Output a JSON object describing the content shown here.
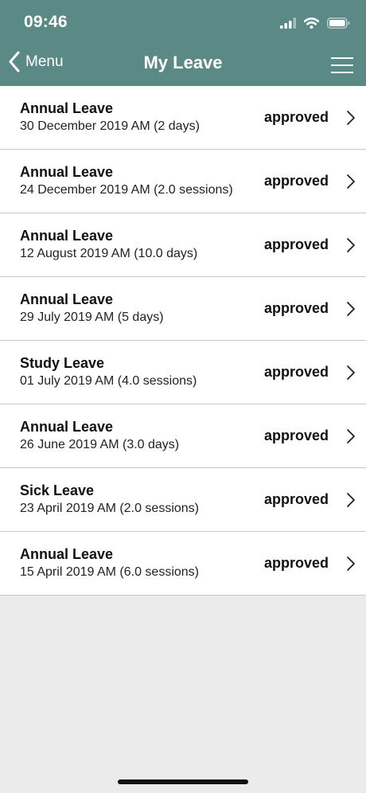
{
  "status_bar": {
    "time": "09:46"
  },
  "nav": {
    "back_label": "Menu",
    "title": "My Leave"
  },
  "leave_items": [
    {
      "type": "Annual Leave",
      "detail": "30 December 2019 AM (2 days)",
      "status": "approved"
    },
    {
      "type": "Annual Leave",
      "detail": "24 December 2019 AM (2.0 sessions)",
      "status": "approved"
    },
    {
      "type": "Annual Leave",
      "detail": "12 August 2019 AM (10.0 days)",
      "status": "approved"
    },
    {
      "type": "Annual Leave",
      "detail": "29 July 2019 AM (5 days)",
      "status": "approved"
    },
    {
      "type": "Study Leave",
      "detail": "01 July 2019 AM (4.0 sessions)",
      "status": "approved"
    },
    {
      "type": "Annual Leave",
      "detail": "26 June 2019 AM (3.0 days)",
      "status": "approved"
    },
    {
      "type": "Sick Leave",
      "detail": "23 April 2019 AM (2.0 sessions)",
      "status": "approved"
    },
    {
      "type": "Annual Leave",
      "detail": "15 April 2019 AM (6.0 sessions)",
      "status": "approved"
    }
  ],
  "colors": {
    "header_bg": "#5b8a86",
    "page_bg": "#ebebeb",
    "row_bg": "#ffffff",
    "divider": "#c8c8c8"
  },
  "icons": {
    "back": "chevron-left-icon",
    "menu": "hamburger-menu-icon",
    "row": "chevron-right-icon",
    "signal": "cellular-signal-icon",
    "wifi": "wifi-icon",
    "battery": "battery-icon"
  }
}
